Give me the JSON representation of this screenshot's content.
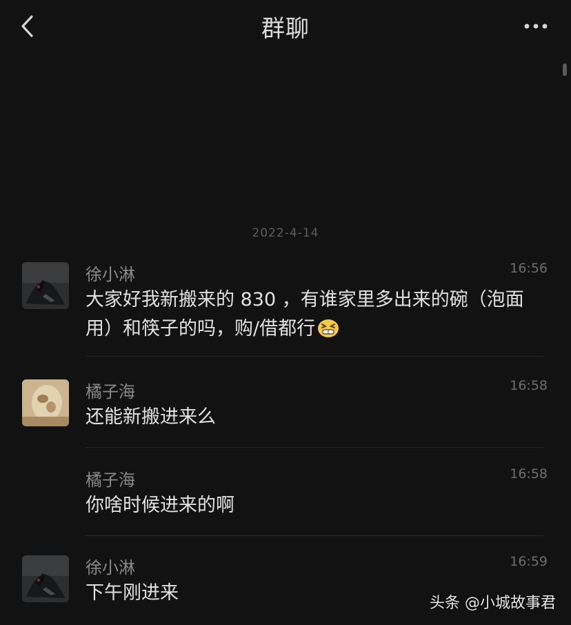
{
  "header": {
    "title": "群聊",
    "back_icon": "chevron-left-icon",
    "more_icon": "more-dots-icon"
  },
  "date_separator": "2022-4-14",
  "messages": [
    {
      "sender": "徐小淋",
      "time": "16:56",
      "text": "大家好我新搬来的 830 ，有谁家里多出来的碗（泡面用）和筷子的吗，购/借都行",
      "emoji": "grimace-emoji",
      "avatar": "dark-figure-avatar"
    },
    {
      "sender": "橘子海",
      "time": "16:58",
      "text": "还能新搬进来么",
      "avatar": "beige-photo-avatar"
    },
    {
      "sender": "橘子海",
      "time": "16:58",
      "text": "你啥时候进来的啊"
    },
    {
      "sender": "徐小淋",
      "time": "16:59",
      "text": "下午刚进来",
      "avatar": "dark-figure-avatar"
    }
  ],
  "watermark": "头条 @小城故事君",
  "colors": {
    "background": "#121212",
    "title": "#dcdcdc",
    "sender": "#8a8a8a",
    "time": "#6e6e6e",
    "message_text": "#e2e2e2"
  }
}
